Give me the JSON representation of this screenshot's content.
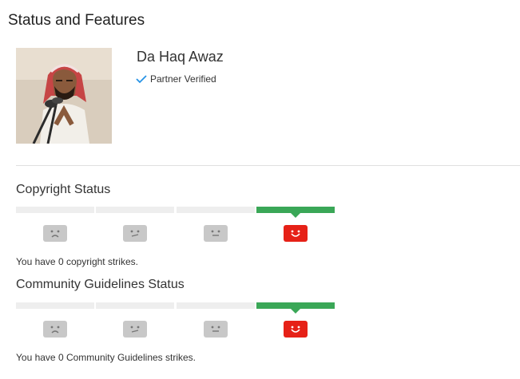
{
  "page": {
    "title": "Status and Features"
  },
  "channel": {
    "name": "Da Haq Awaz",
    "verification": "Partner Verified",
    "avatar_icon": "channel-avatar-photo"
  },
  "copyright": {
    "title": "Copyright Status",
    "level": 4,
    "levels": [
      "sad",
      "meh",
      "neutral",
      "happy"
    ],
    "message": "You have 0 copyright strikes."
  },
  "community": {
    "title": "Community Guidelines Status",
    "level": 4,
    "levels": [
      "sad",
      "meh",
      "neutral",
      "happy"
    ],
    "message": "You have 0 Community Guidelines strikes."
  },
  "colors": {
    "active_bar": "#3aa757",
    "inactive_bar": "#eeeeee",
    "active_face": "#e62117",
    "inactive_face": "#c8c8c8",
    "check": "#2793e6"
  }
}
